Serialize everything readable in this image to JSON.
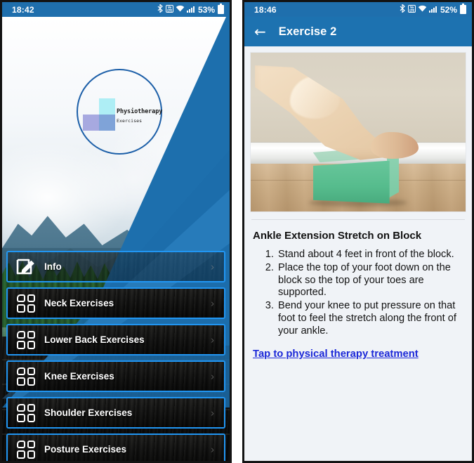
{
  "left_phone": {
    "status_bar": {
      "time": "18:42",
      "battery_percent": "53%",
      "icons": [
        "bluetooth-icon",
        "volte-icon",
        "wifi-icon",
        "signal-bars-icon",
        "battery-icon"
      ],
      "volte_label": "VoLTE"
    },
    "logo": {
      "title": "Physiotherapy",
      "subtitle": "Exercises",
      "circle_color": "#1c5fa8",
      "square_cyan": "#aeeef5",
      "square_purple": "#a7a9e0",
      "square_blue": "#7fa3d8"
    },
    "menu": {
      "items": [
        {
          "label": "Info",
          "icon": "edit-note-icon",
          "chevron": "›",
          "translucent": true
        },
        {
          "label": "Neck Exercises",
          "icon": "grid-icon",
          "chevron": "›",
          "translucent": false
        },
        {
          "label": "Lower Back Exercises",
          "icon": "grid-icon",
          "chevron": "›",
          "translucent": false
        },
        {
          "label": "Knee Exercises",
          "icon": "grid-icon",
          "chevron": "›",
          "translucent": false
        },
        {
          "label": "Shoulder Exercises",
          "icon": "grid-icon",
          "chevron": "›",
          "translucent": false
        },
        {
          "label": "Posture Exercises",
          "icon": "grid-icon",
          "chevron": "›",
          "translucent": false
        }
      ],
      "accent_color": "#2196f3"
    }
  },
  "right_phone": {
    "status_bar": {
      "time": "18:46",
      "battery_percent": "52%",
      "icons": [
        "bluetooth-icon",
        "volte-icon",
        "wifi-icon",
        "signal-bars-icon",
        "battery-icon"
      ],
      "volte_label": "VoLTE"
    },
    "app_bar": {
      "back_arrow": "←",
      "title": "Exercise 2",
      "color": "#1d72b0"
    },
    "exercise": {
      "photo_alt": "foot resting on green foam yoga block",
      "title": "Ankle Extension Stretch on Block",
      "steps": [
        "Stand about 4 feet in front of the block.",
        "Place the top of your foot down on the block so the top of your toes are supported.",
        "Bend your knee to put pressure on that foot to feel the stretch along the front of your ankle."
      ],
      "link_text": "Tap to physical therapy treatment",
      "link_color": "#1b28d8"
    }
  }
}
